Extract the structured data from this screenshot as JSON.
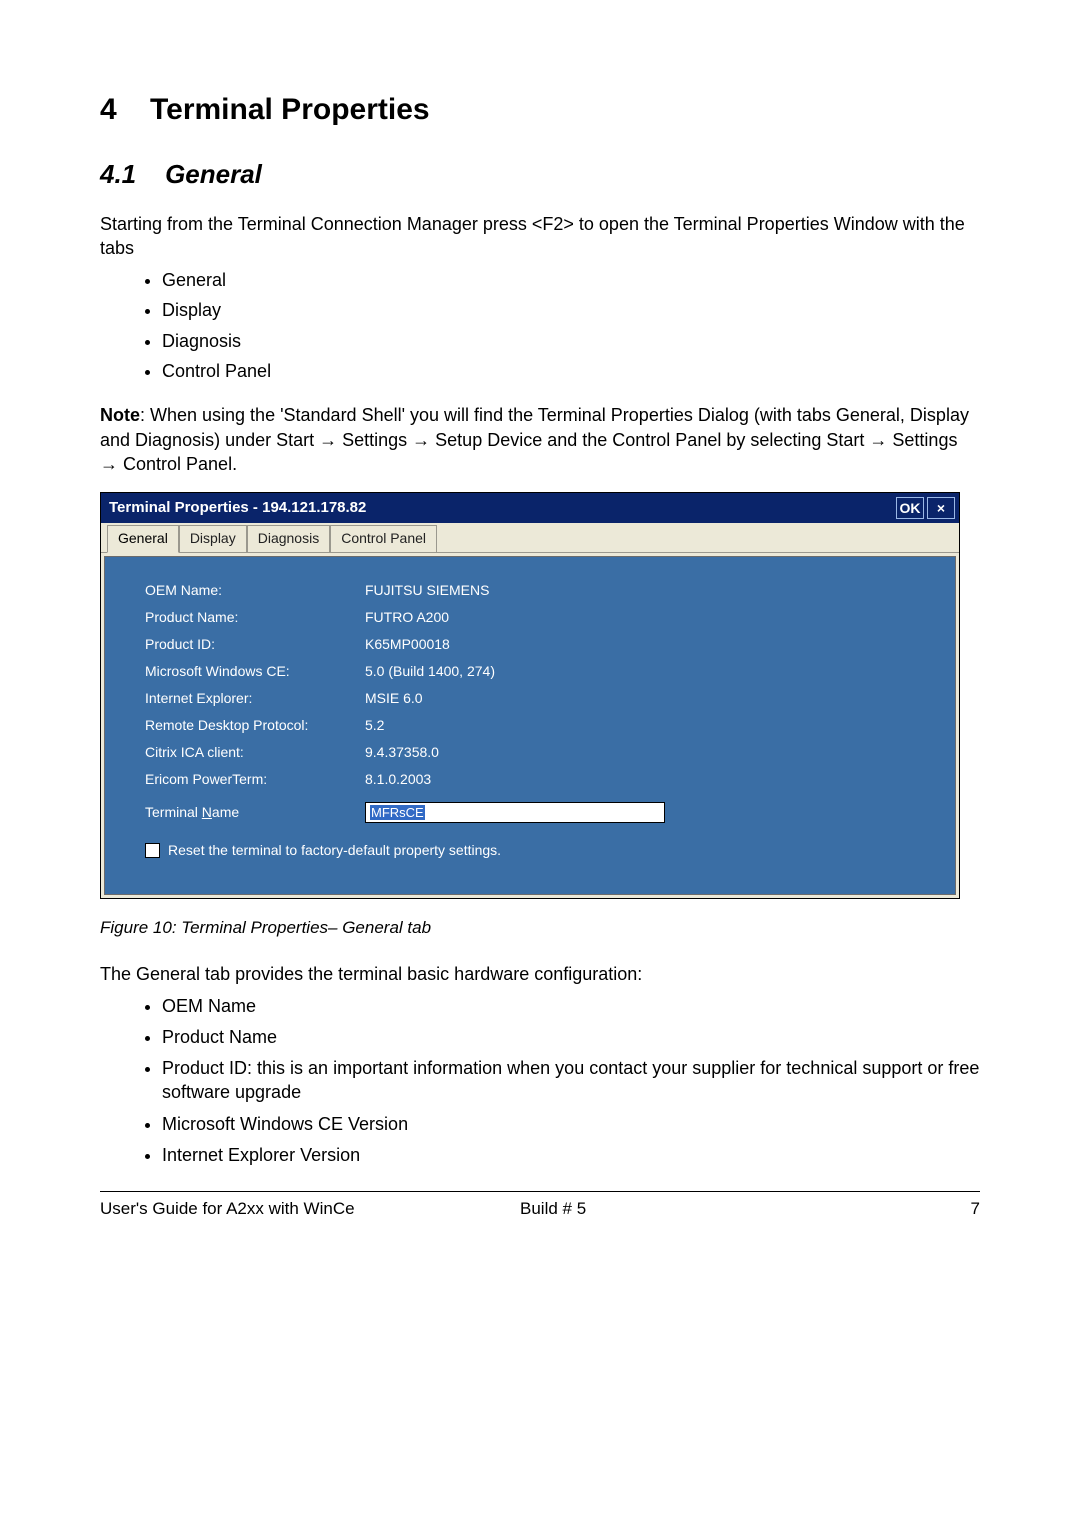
{
  "heading": {
    "number": "4",
    "title": "Terminal Properties",
    "sub_number": "4.1",
    "sub_title": "General"
  },
  "intro": {
    "paragraph": "Starting from the Terminal Connection Manager press <F2> to open the Terminal Properties Window with the tabs",
    "bullets": [
      "General",
      "Display",
      "Diagnosis",
      "Control Panel"
    ]
  },
  "note": {
    "label": "Note",
    "text": ": When using the 'Standard Shell' you will find the Terminal Properties Dialog (with tabs General, Display and Diagnosis) under Start → Settings → Setup Device and the Control Panel by selecting Start → Settings → Control Panel."
  },
  "window": {
    "title": "Terminal Properties - 194.121.178.82",
    "ok_label": "OK",
    "close_label": "×",
    "tabs": [
      "General",
      "Display",
      "Diagnosis",
      "Control Panel"
    ],
    "active_tab_index": 0,
    "rows": [
      {
        "label": "OEM Name:",
        "value": "FUJITSU SIEMENS"
      },
      {
        "label": "Product Name:",
        "value": "FUTRO A200"
      },
      {
        "label": "Product ID:",
        "value": "K65MP00018"
      },
      {
        "label": "Microsoft Windows CE:",
        "value": "5.0  (Build 1400, 274)"
      },
      {
        "label": "Internet Explorer:",
        "value": "MSIE 6.0"
      },
      {
        "label": "Remote Desktop Protocol:",
        "value": "5.2"
      },
      {
        "label": "Citrix ICA client:",
        "value": "9.4.37358.0"
      },
      {
        "label": "Ericom PowerTerm:",
        "value": "8.1.0.2003"
      }
    ],
    "terminal_name": {
      "label_prefix": "Terminal ",
      "label_underlined": "N",
      "label_suffix": "ame",
      "value": "MFRsCE"
    },
    "reset": {
      "label_underlined": "R",
      "label_suffix": "eset the terminal to factory-default property settings."
    }
  },
  "caption": "Figure 10:  Terminal Properties– General tab",
  "after": {
    "paragraph": "The General tab provides the terminal basic hardware configuration:",
    "bullets": [
      "OEM Name",
      "Product Name",
      "Product ID: this is an important information when you contact your supplier for technical support or free software upgrade",
      "Microsoft Windows CE Version",
      "Internet Explorer Version"
    ]
  },
  "footer": {
    "left": "User's Guide for A2xx with WinCe",
    "mid": "Build # 5",
    "right": "7"
  }
}
